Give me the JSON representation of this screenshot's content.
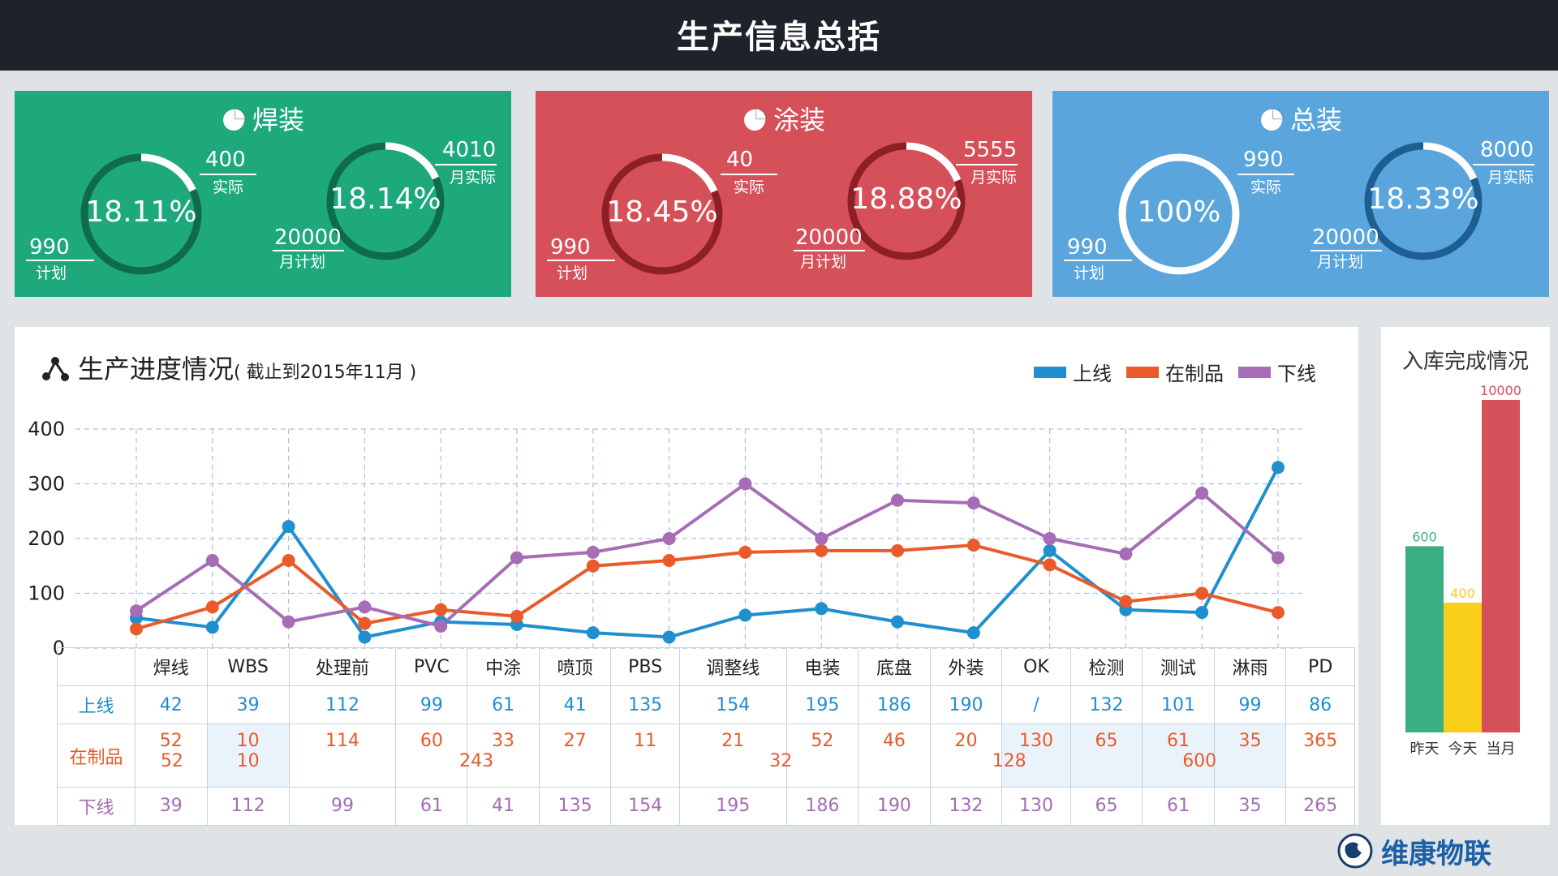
{
  "header": {
    "title": "生产信息总括"
  },
  "kpis": [
    {
      "title": "焊装",
      "color": "#1ea97c",
      "ring_color": "#0f6b49",
      "daily": {
        "percent": "18.11%",
        "actual": "400",
        "actual_label": "实际",
        "plan": "990",
        "plan_label": "计划",
        "fraction": 0.1811
      },
      "monthly": {
        "percent": "18.14%",
        "actual": "4010",
        "actual_label": "月实际",
        "plan": "20000",
        "plan_label": "月计划",
        "fraction": 0.1814
      }
    },
    {
      "title": "涂装",
      "color": "#d6505a",
      "ring_color": "#8f1f27",
      "daily": {
        "percent": "18.45%",
        "actual": "40",
        "actual_label": "实际",
        "plan": "990",
        "plan_label": "计划",
        "fraction": 0.1845
      },
      "monthly": {
        "percent": "18.88%",
        "actual": "5555",
        "actual_label": "月实际",
        "plan": "20000",
        "plan_label": "月计划",
        "fraction": 0.1888
      }
    },
    {
      "title": "总装",
      "color": "#5aa6dc",
      "ring_color": "#1d5f93",
      "daily": {
        "percent": "100%",
        "actual": "990",
        "actual_label": "实际",
        "plan": "990",
        "plan_label": "计划",
        "fraction": 1.0
      },
      "monthly": {
        "percent": "18.33%",
        "actual": "8000",
        "actual_label": "月实际",
        "plan": "20000",
        "plan_label": "月计划",
        "fraction": 0.1833
      }
    }
  ],
  "progress": {
    "title": "生产进度情况",
    "subtitle": "( 截止到2015年11月 )",
    "legend": [
      {
        "name": "上线",
        "color": "#1f8fd0"
      },
      {
        "name": "在制品",
        "color": "#ea5a2a"
      },
      {
        "name": "下线",
        "color": "#a66cb5"
      }
    ]
  },
  "chart_data": [
    {
      "type": "line",
      "categories": [
        "焊线",
        "WBS",
        "处理前",
        "PVC",
        "中涂",
        "喷顶",
        "PBS",
        "调整线",
        "电装",
        "底盘",
        "外装",
        "OK",
        "检测",
        "测试",
        "淋雨",
        "PD"
      ],
      "ylim": [
        0,
        400
      ],
      "yticks": [
        0,
        100,
        200,
        300,
        400
      ],
      "grid": true,
      "legend_position": "top-right",
      "series": [
        {
          "name": "上线",
          "color": "#1f8fd0",
          "values": [
            55,
            38,
            222,
            20,
            48,
            43,
            28,
            20,
            60,
            72,
            48,
            28,
            178,
            70,
            65,
            330
          ]
        },
        {
          "name": "在制品",
          "color": "#ea5a2a",
          "values": [
            35,
            75,
            160,
            45,
            70,
            58,
            150,
            160,
            175,
            178,
            178,
            188,
            152,
            85,
            100,
            65
          ]
        },
        {
          "name": "下线",
          "color": "#a66cb5",
          "values": [
            68,
            160,
            48,
            75,
            40,
            165,
            175,
            200,
            300,
            200,
            270,
            265,
            200,
            172,
            283,
            165
          ]
        }
      ]
    },
    {
      "type": "bar",
      "title": "入库完成情况",
      "categories": [
        "昨天",
        "今天",
        "当月"
      ],
      "values": [
        600,
        400,
        10000
      ],
      "data_labels": [
        "600",
        "400",
        "10000"
      ],
      "colors": [
        "#3aaf84",
        "#f9cf1a",
        "#d6505a"
      ],
      "bar_fill_fractions": [
        0.56,
        0.39,
        1.0
      ]
    }
  ],
  "table": {
    "headers": [
      "焊线",
      "WBS",
      "处理前",
      "PVC",
      "中涂",
      "喷顶",
      "PBS",
      "调整线",
      "电装",
      "底盘",
      "外装",
      "OK",
      "检测",
      "测试",
      "淋雨",
      "PD"
    ],
    "row_online": {
      "label": "上线",
      "values": [
        "42",
        "39",
        "112",
        "99",
        "61",
        "41",
        "135",
        "154",
        "195",
        "186",
        "190",
        "/",
        "132",
        "101",
        "99",
        "86"
      ]
    },
    "row_wip": {
      "label": "在制品",
      "values": [
        "52",
        "10",
        "114",
        "60",
        "33",
        "27",
        "11",
        "21",
        "52",
        "46",
        "20",
        "130",
        "65",
        "61",
        "35",
        "365"
      ],
      "subtotals": [
        "52",
        "10",
        "243",
        "32",
        "128",
        "600"
      ]
    },
    "row_offline": {
      "label": "下线",
      "values": [
        "39",
        "112",
        "99",
        "61",
        "41",
        "135",
        "154",
        "195",
        "186",
        "190",
        "132",
        "130",
        "65",
        "61",
        "35",
        "265"
      ]
    }
  },
  "brand": {
    "name": "维康物联"
  }
}
